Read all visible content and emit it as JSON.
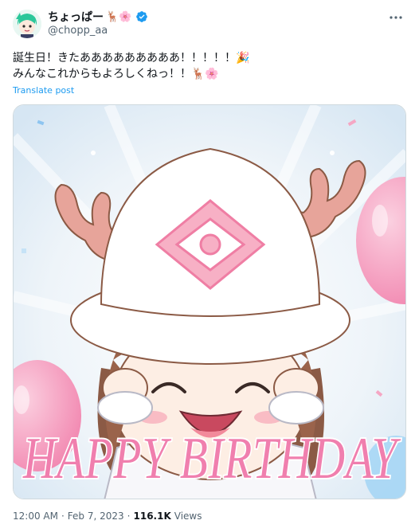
{
  "author": {
    "display_name": "ちょっぱー",
    "name_emojis": "🦌🌸",
    "handle": "@chopp_aa",
    "verified": true
  },
  "tweet": {
    "line1": "誕生日！きたあああああああああ！！！！！🎉",
    "line2": "みんなこれからもよろしくねっ！！🦌🌸",
    "translate_label": "Translate post"
  },
  "media": {
    "banner_text": "HAPPY BIRTHDAY"
  },
  "meta": {
    "time": "12:00 AM",
    "separator": "·",
    "date": "Feb 7, 2023",
    "views_count": "116.1K",
    "views_label": "Views"
  },
  "colors": {
    "accent": "#1d9bf0",
    "secondary_text": "#536471",
    "banner_pink": "#f07fae",
    "balloon_pink": "#f7a3c1"
  },
  "icons": {
    "more": "more-horizontal-icon",
    "verified": "verified-badge-icon"
  }
}
